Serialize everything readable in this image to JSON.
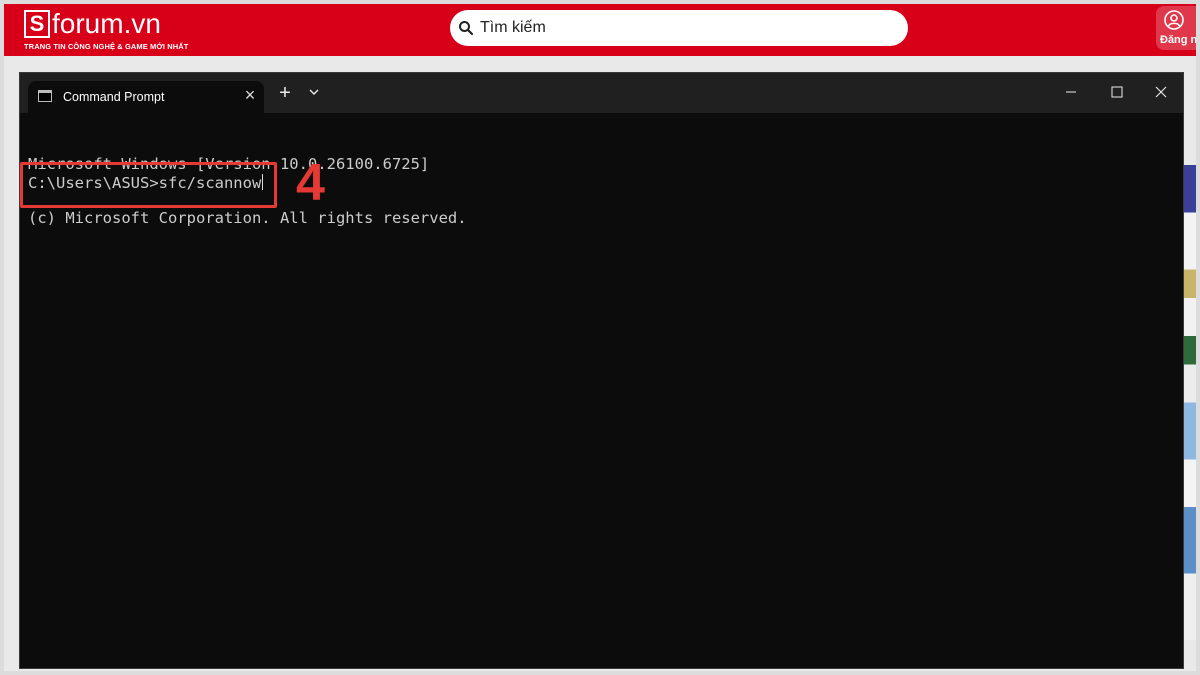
{
  "site": {
    "logo_letter": "S",
    "logo_word": "forum.vn",
    "tagline": "TRANG TIN CÔNG NGHỆ & GAME MỚI NHẤT",
    "search_placeholder": "Tìm kiếm",
    "login_label": "Đăng n",
    "brand_color": "#d70018"
  },
  "terminal": {
    "tab_label": "Command Prompt",
    "tab_close": "×",
    "new_tab": "+",
    "min_symbol": "—",
    "max_symbol": "□",
    "close_symbol": "✕",
    "lines": [
      "Microsoft Windows [Version 10.0.26100.6725]",
      "(c) Microsoft Corporation. All rights reserved."
    ],
    "prompt": "C:\\Users\\ASUS>",
    "command": "sfc/scannow"
  },
  "annotation": {
    "step": "4",
    "color": "#e53935"
  }
}
